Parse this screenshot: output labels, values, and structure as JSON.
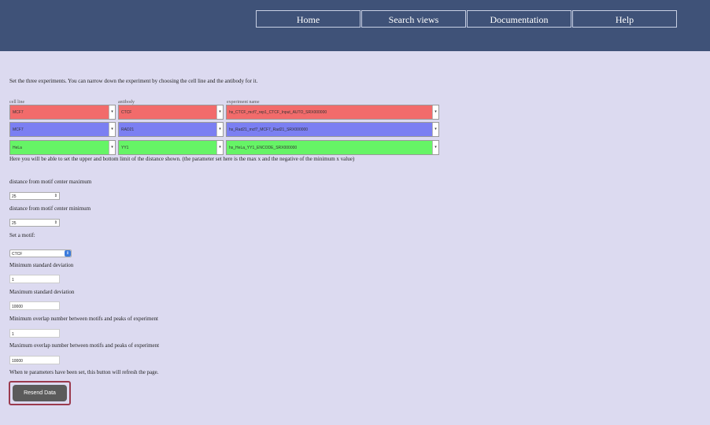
{
  "nav": {
    "items": [
      "Home",
      "Search views",
      "Documentation",
      "Help"
    ]
  },
  "intro": "Set the three experiments. You can narrow down the experiment by choosing the cell line and the antibody for it.",
  "column_labels": {
    "cell_line": "cell line",
    "antibody": "antibody",
    "experiment": "experiment name"
  },
  "experiments": [
    {
      "cell_line": "MCF7",
      "antibody": "CTCF",
      "name": "hs_CTCF_mcf7_rep1_CTCF_Input_AUTO_SRX000000",
      "color": "#f26b6b"
    },
    {
      "cell_line": "MCF7",
      "antibody": "RAD21",
      "name": "hs_Rad21_mcf7_MCF7_Rad21_SRX000000",
      "color": "#7b7ff2"
    },
    {
      "cell_line": "HeLa",
      "antibody": "YY1",
      "name": "hs_HeLa_YY1_ENCODE_SRX000000",
      "color": "#66f466"
    }
  ],
  "distance_note": "Here you will be able to set the upper and bottom limit of the distance shown. (the parameter set here is the max x and the negative of the minimum x value)",
  "distance_max": {
    "label": "distance from motif center maximum",
    "value": "25"
  },
  "distance_min": {
    "label": "distance from motif center minimum",
    "value": "25"
  },
  "motif": {
    "label": "Set a motif:",
    "value": "CTCF"
  },
  "min_std": {
    "label": "Minimum standard deviation",
    "value": "1"
  },
  "max_std": {
    "label": "Maximum standard deviation",
    "value": "10000"
  },
  "min_overlap": {
    "label": "Minimum overlap number between motifs and peaks of experiment",
    "value": "1"
  },
  "max_overlap": {
    "label": "Maximum overlap number between motifs and peaks of experiment",
    "value": "10000"
  },
  "refresh_note": "When te parameters have been set, this button will refresh the page.",
  "resend_label": "Resend Data"
}
